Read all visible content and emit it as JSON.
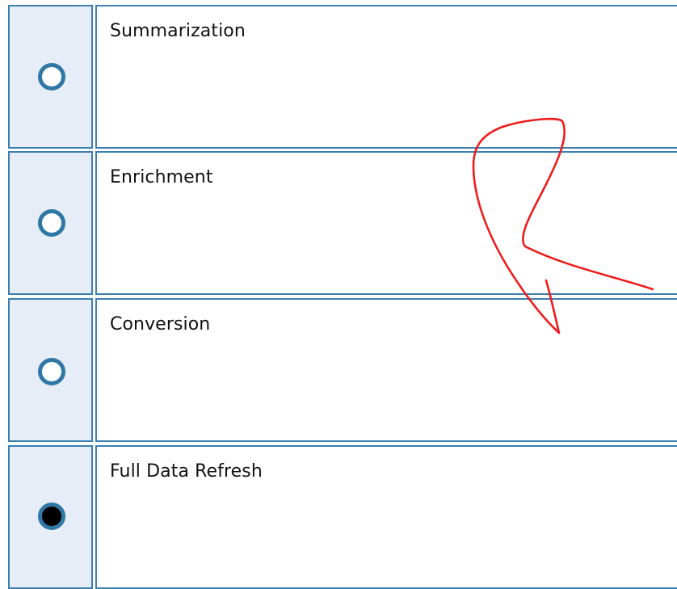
{
  "options": [
    {
      "label": "Summarization",
      "selected": false
    },
    {
      "label": "Enrichment",
      "selected": false
    },
    {
      "label": "Conversion",
      "selected": false
    },
    {
      "label": "Full Data Refresh",
      "selected": true
    }
  ],
  "colors": {
    "border": "#3c7fb1",
    "radio_border": "#2f78a6",
    "radio_cell_bg": "#e6edf6",
    "annotation": "#ee1c1c"
  },
  "annotation": {
    "type": "freehand-arrow"
  }
}
